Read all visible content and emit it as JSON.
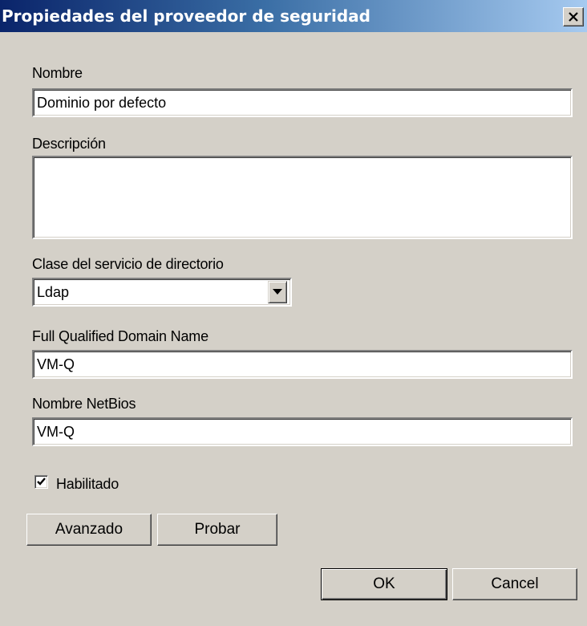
{
  "window": {
    "title": "Propiedades del proveedor de seguridad"
  },
  "form": {
    "nombre_label": "Nombre",
    "nombre_value": "Dominio por defecto",
    "descripcion_label": "Descripción",
    "descripcion_value": "",
    "clase_label": "Clase del servicio de directorio",
    "clase_value": "Ldap",
    "fqdn_label": "Full Qualified Domain Name",
    "fqdn_value": "VM-Q",
    "netbios_label": "Nombre NetBios",
    "netbios_value": "VM-Q",
    "habilitado_label": "Habilitado",
    "habilitado_checked": true
  },
  "buttons": {
    "avanzado": "Avanzado",
    "probar": "Probar",
    "ok": "OK",
    "cancel": "Cancel"
  },
  "icons": {
    "close": "close-icon",
    "dropdown": "chevron-down-icon",
    "check": "checkmark-icon"
  },
  "colors": {
    "title_start": "#0a246a",
    "title_end": "#a6caf0",
    "face": "#d4d0c8"
  }
}
